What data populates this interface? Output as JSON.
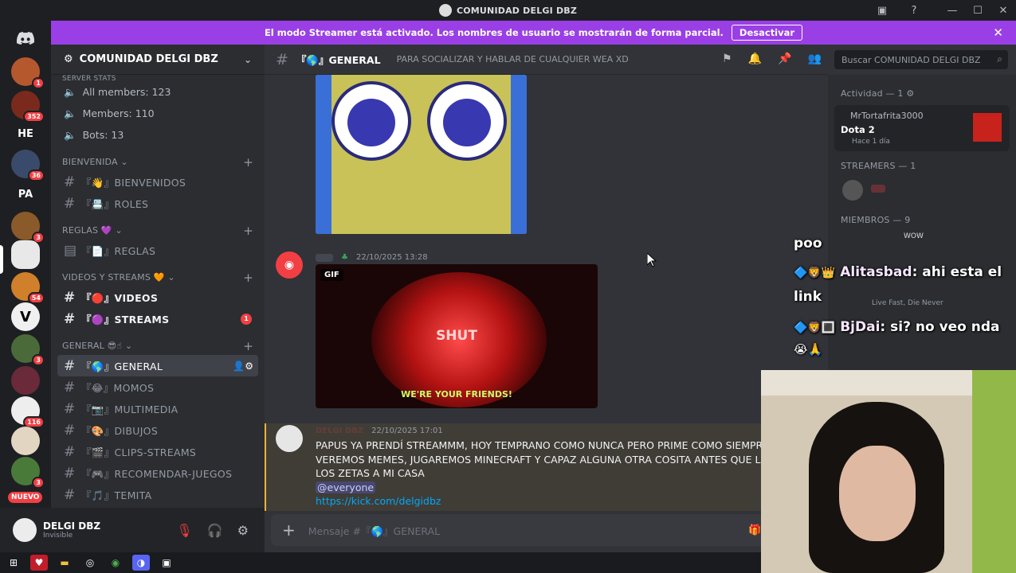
{
  "window": {
    "title": "COMUNIDAD DELGI DBZ"
  },
  "banner": {
    "text": "El modo Streamer está activado. Los nombres de usuario se mostrarán de forma parcial.",
    "button": "Desactivar"
  },
  "guilds": {
    "badges": [
      "1",
      "352",
      "36",
      "3",
      "54",
      "116",
      "3",
      "3"
    ],
    "text_icons": [
      "HE",
      "PA"
    ],
    "new_label": "NUEVO"
  },
  "server": {
    "name": "COMUNIDAD DELGI DBZ"
  },
  "stats": {
    "category": "SERVER STATS",
    "all_members": "All members: 123",
    "members": "Members: 110",
    "bots": "Bots: 13"
  },
  "categories": {
    "bienvenida": "BIENVENIDA",
    "reglas": "REGLAS",
    "videos": "VIDEOS Y STREAMS",
    "general": "GENERAL"
  },
  "channels": {
    "bienvenidos": "『👋』BIENVENIDOS",
    "roles": "『📇』ROLES",
    "reglas": "『📄』REGLAS",
    "videos": "『🔴』VIDEOS",
    "streams": "『🟣』STREAMS",
    "streams_badge": "1",
    "general": "『🌎』GENERAL",
    "momos": "『😂』MOMOS",
    "multimedia": "『📷』MULTIMEDIA",
    "dibujos": "『🎨』DIBUJOS",
    "clips": "『🎬』CLIPS-STREAMS",
    "recomendar": "『🎮』RECOMENDAR-JUEGOS",
    "temita": "『🎵』TEMITA"
  },
  "user": {
    "name": "DELGI DBZ",
    "status": "Invisible"
  },
  "header": {
    "channel": "『🌎』GENERAL",
    "topic": "PARA SOCIALIZAR Y HABLAR DE CUALQUIER WEA XD",
    "search_placeholder": "Buscar COMUNIDAD DELGI DBZ"
  },
  "messages": {
    "m1_time": "22/10/2025 13:28",
    "gif_label": "GIF",
    "gif_text_top": "SHUT",
    "gif_text_bottom": "WE'RE YOUR FRIENDS!",
    "m2_author": "DELGI DBZ",
    "m2_time": "22/10/2025 17:01",
    "m2_text": "PAPUS YA PRENDÍ STREAMMM, HOY TEMPRANO COMO NUNCA PERO PRIME COMO SIEMPRE VEREMOS MEMES, JUGAREMOS MINECRAFT Y CAPAZ ALGUNA OTRA COSITA ANTES QUE LLEGUEN LOS ZETAS A MI CASA",
    "m2_mention": "@everyone",
    "m2_link": "https://kick.com/delgidbz"
  },
  "composer": {
    "placeholder": "Mensaje #『🌎』GENERAL"
  },
  "members_panel": {
    "activity_title": "Actividad — 1",
    "activity_user": "MrTortafrita3000",
    "activity_game": "Dota 2",
    "activity_time": "Hace 1 día",
    "streamers_title": "STREAMERS — 1",
    "members_title": "MIEMBROS — 9",
    "member_status_1": "WOW",
    "member_status_2": "Live Fast, Die Never"
  },
  "overlay": {
    "line1": "poo",
    "user2": "Alitasbad",
    "msg2": ": ahi esta el",
    "line3": "link",
    "user4": "BjDai",
    "msg4": ": si? no veo nda"
  },
  "colors": {
    "accent": "#9a3fe6",
    "bg": "#313338",
    "sidebar": "#2b2d31",
    "server_rail": "#1e1f22"
  }
}
